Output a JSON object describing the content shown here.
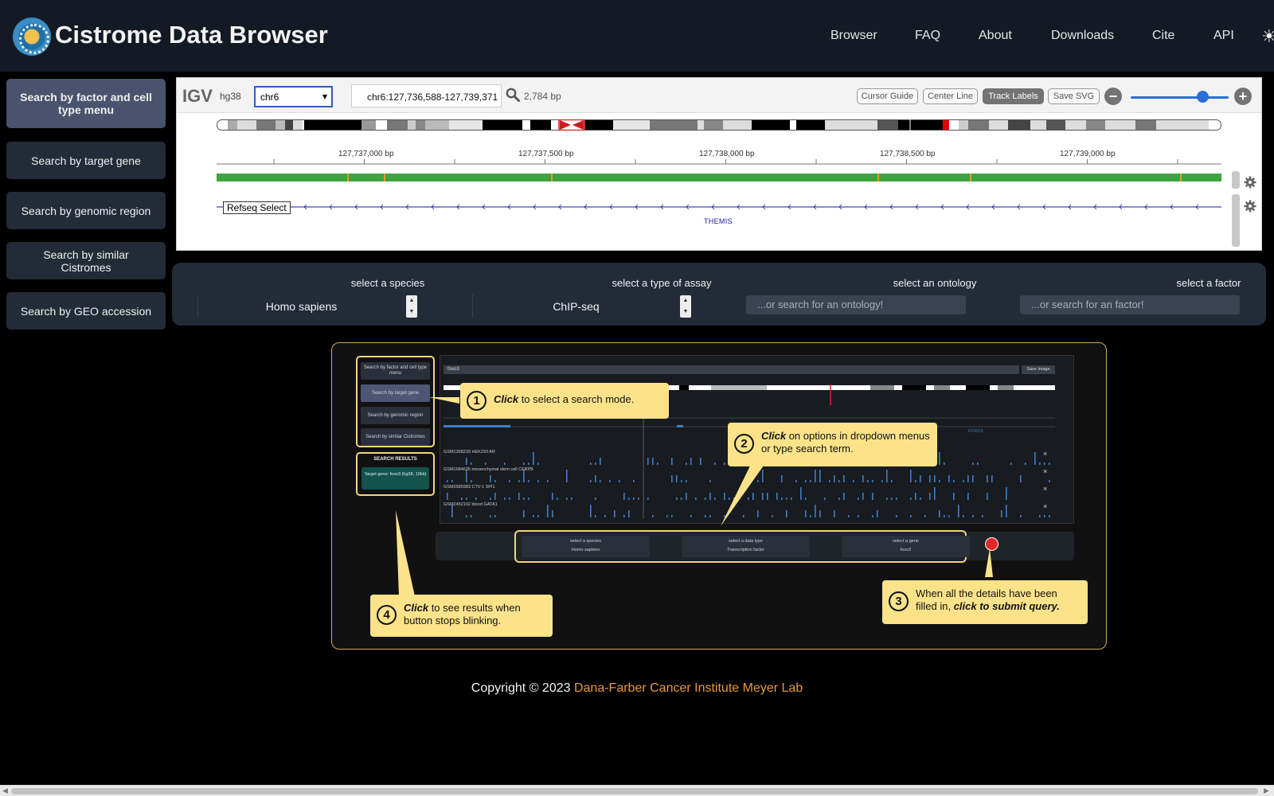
{
  "header": {
    "brand": "Cistrome Data Browser",
    "nav": [
      "Browser",
      "FAQ",
      "About",
      "Downloads",
      "Cite",
      "API"
    ],
    "theme_icon": "sun-icon"
  },
  "sidebar": {
    "items": [
      {
        "label": "Search by factor and cell type menu",
        "active": true
      },
      {
        "label": "Search by target gene",
        "active": false
      },
      {
        "label": "Search by genomic region",
        "active": false
      },
      {
        "label": "Search by similar Cistromes",
        "active": false
      },
      {
        "label": "Search by GEO accession",
        "active": false
      }
    ]
  },
  "igv": {
    "logo": "IGV",
    "genome": "hg38",
    "chromosome": "chr6",
    "locus": "chr6:127,736,588-127,739,371",
    "width": "2,784 bp",
    "buttons": [
      "Cursor Guide",
      "Center Line",
      "Track Labels",
      "Save SVG"
    ],
    "active_button": "Track Labels",
    "zoom_out": "−",
    "zoom_in": "+",
    "zoom_fraction": 0.68,
    "ruler_ticks": [
      "127,737,000 bp",
      "127,737,500 bp",
      "127,738,000 bp",
      "127,738,500 bp",
      "127,739,000 bp"
    ],
    "track_label": "Refseq Select",
    "gene_name": "THEMIS"
  },
  "filters": {
    "species_label": "select a species",
    "species_value": "Homo sapiens",
    "assay_label": "select a type of assay",
    "assay_value": "ChIP-seq",
    "ontology_label": "select an ontology",
    "ontology_placeholder": "...or search for an ontology!",
    "factor_label": "select a factor",
    "factor_placeholder": "...or search for an factor!"
  },
  "tutorial": {
    "mini_sidebar": [
      "Search by factor and cell type menu",
      "Search by target gene",
      "Search by genomic region",
      "Search by similar Cistromes"
    ],
    "search_results_title": "SEARCH RESULTS",
    "search_results_item": "Target gene: foxo3 (hg38, 10kb)",
    "mini_locus": "foxo3",
    "mini_save": "Save Image",
    "mini_tracks": [
      "GSM1308233 HEK293 AR",
      "GSM1684635 mesenchymal stem cell CEBPB",
      "GSM3586983 CTV-1 SPI1",
      "GSM2452102 blood GATA1"
    ],
    "mini_gene": "FOXO3",
    "mini_filters": [
      {
        "label": "select a species",
        "value": "Homo sapiens"
      },
      {
        "label": "select a data type",
        "value": "Transcription factor"
      },
      {
        "label": "select a gene",
        "value": "foxo3"
      }
    ],
    "callouts": [
      {
        "num": "1",
        "bold": "Click",
        "text": " to select a search mode."
      },
      {
        "num": "2",
        "bold": "Click",
        "text": " on options in dropdown menus or type search term."
      },
      {
        "num": "3",
        "text": "When all the details have been filled in, ",
        "bold": "click to submit query."
      },
      {
        "num": "4",
        "bold": "Click",
        "text": " to see results when button stops blinking."
      }
    ]
  },
  "footer": {
    "copyright": "Copyright © 2023 ",
    "org": "Dana-Farber Cancer Institute Meyer Lab"
  }
}
